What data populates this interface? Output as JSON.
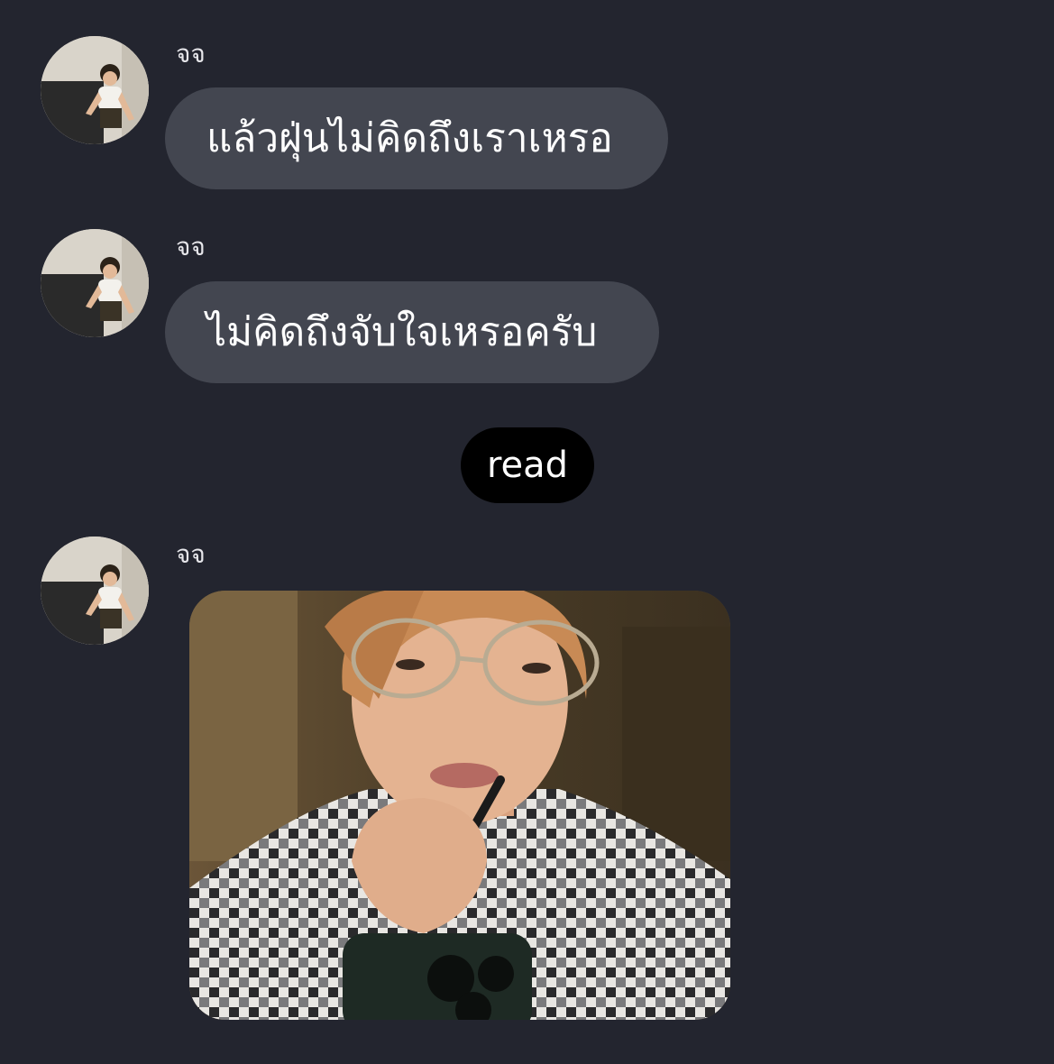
{
  "colors": {
    "background": "#23252f",
    "bubble": "#434650",
    "read_pill": "#000000",
    "text": "#ffffff"
  },
  "messages": [
    {
      "sender": "จจ",
      "text": "แล้วฝุ่นไม่คิดถึงเราเหรอ"
    },
    {
      "sender": "จจ",
      "text": "ไม่คิดถึงจับใจเหรอครับ"
    },
    {
      "sender": "จจ",
      "type": "image"
    }
  ],
  "read_indicator": "read"
}
